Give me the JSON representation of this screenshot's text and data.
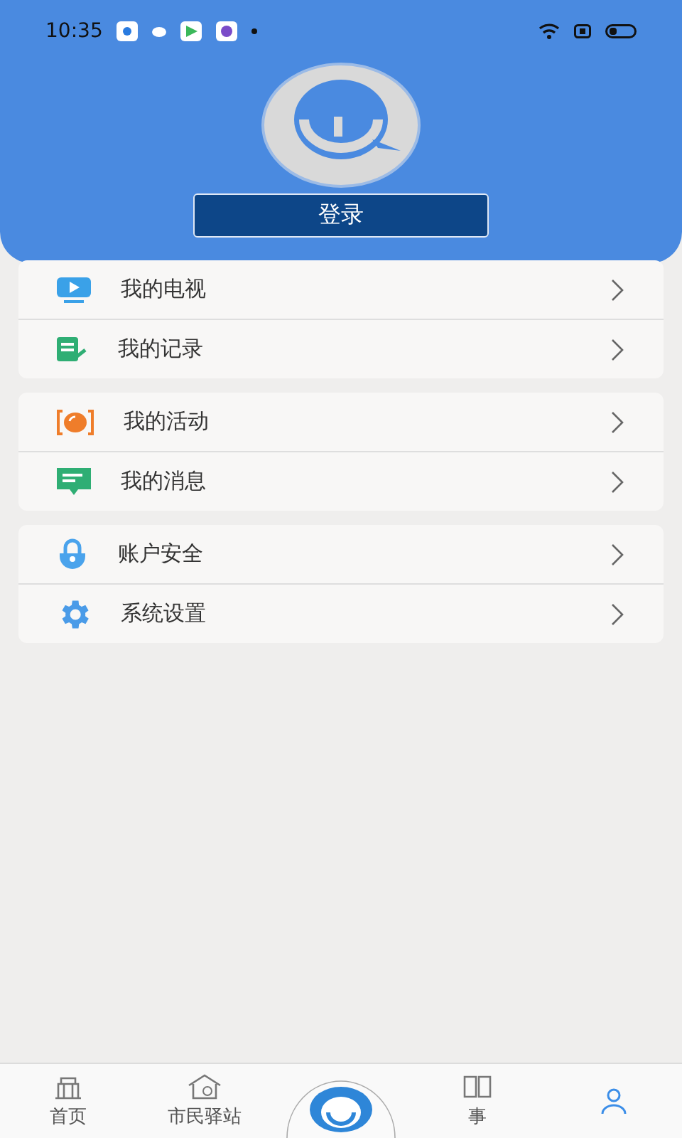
{
  "status_bar": {
    "time": "10:35"
  },
  "header": {
    "login_button": "登录"
  },
  "menu_groups": [
    {
      "items": [
        {
          "kind": "tv",
          "label": "我的电视"
        },
        {
          "kind": "record",
          "label": "我的记录"
        }
      ]
    },
    {
      "items": [
        {
          "kind": "activity",
          "label": "我的活动"
        },
        {
          "kind": "message",
          "label": "我的消息"
        }
      ]
    },
    {
      "items": [
        {
          "kind": "lock",
          "label": "账户安全"
        },
        {
          "kind": "gear",
          "label": "系统设置"
        }
      ]
    }
  ],
  "tab_bar": [
    {
      "kind": "home",
      "label": "首页",
      "selected": false
    },
    {
      "kind": "station",
      "label": "市民驿站",
      "selected": false
    },
    {
      "kind": "logo",
      "selected": false
    },
    {
      "kind": "story",
      "label": "事",
      "selected": false
    },
    {
      "kind": "mine",
      "selected": true
    }
  ]
}
